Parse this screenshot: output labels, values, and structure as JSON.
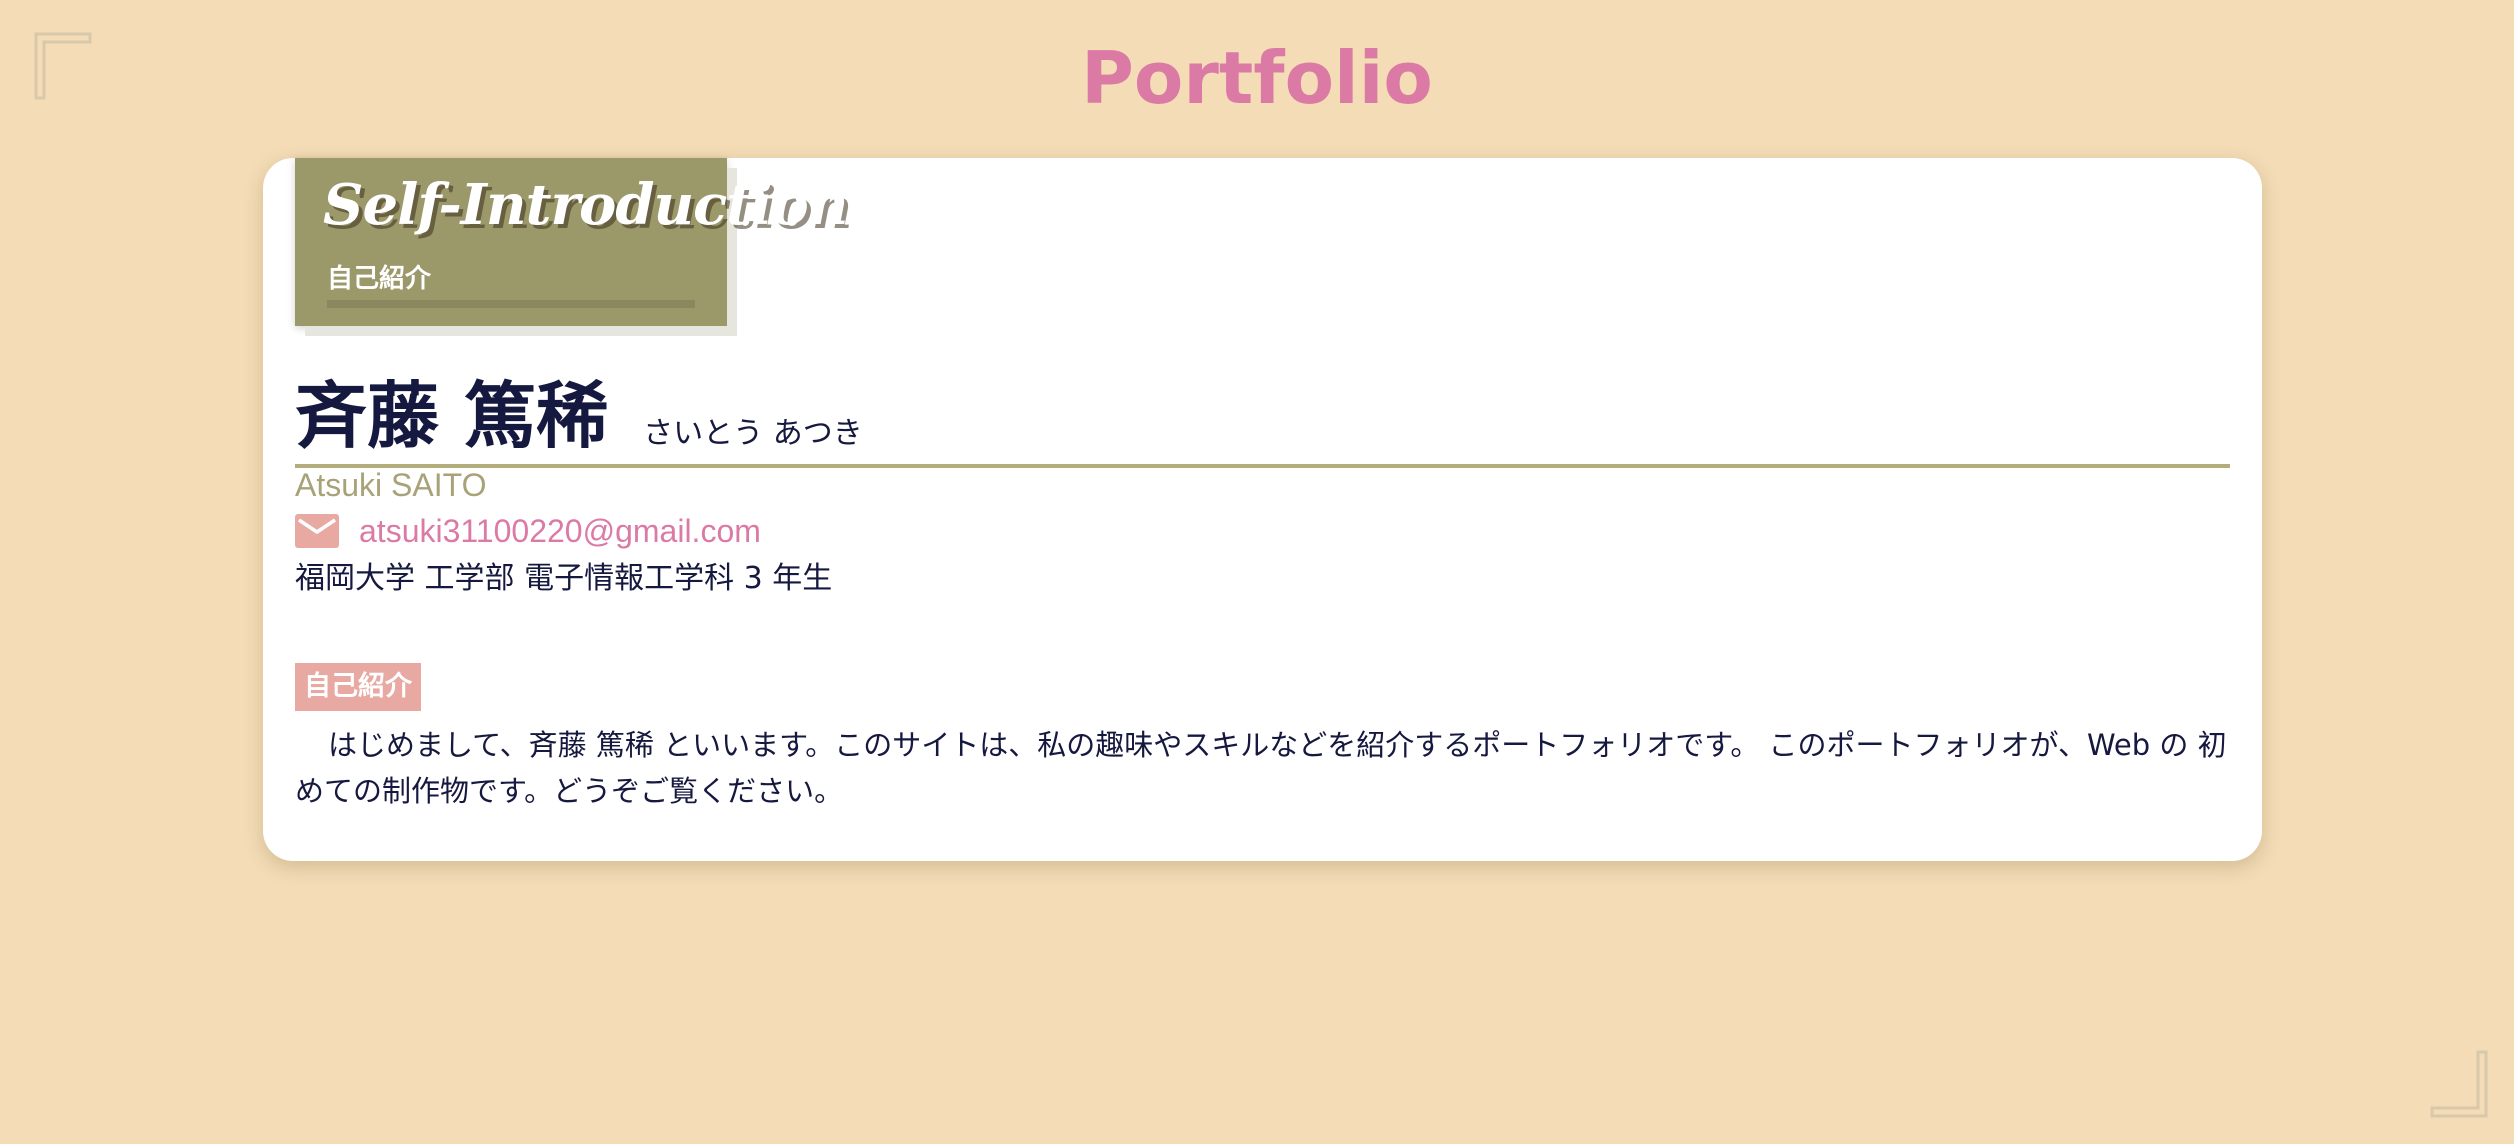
{
  "page": {
    "title": "Portfolio"
  },
  "section": {
    "title_en": "Self-Introduction",
    "title_ja": "自己紹介"
  },
  "profile": {
    "name_kanji": "斉藤 篤稀",
    "name_kana": "さいとう あつき",
    "name_roman": "Atsuki SAITO",
    "email_icon": "mail-icon",
    "email": "atsuki31100220@gmail.com",
    "affiliation": "福岡大学 工学部 電子情報工学科 3 年生"
  },
  "intro": {
    "label": "自己紹介",
    "text": "はじめまして、斉藤 篤稀 といいます。このサイトは、私の趣味やスキルなどを紹介するポートフォリオです。 このポートフォリオが、Web の 初めての制作物です。どうぞご覧ください。"
  },
  "colors": {
    "background": "#f3dcb6",
    "title_pink": "#dc7aa6",
    "tag_olive": "#9b986a",
    "text_navy": "#16193f",
    "label_pink": "#e9a9a3"
  }
}
